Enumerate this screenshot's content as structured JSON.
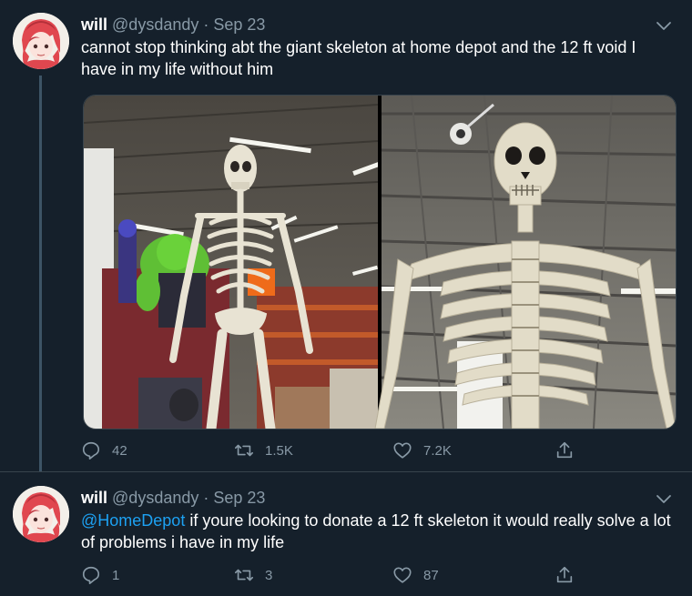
{
  "tweets": [
    {
      "name": "will",
      "handle": "@dysdandy",
      "separator": "·",
      "date": "Sep 23",
      "text": "cannot stop thinking abt the giant skeleton at home depot and the 12 ft void I have in my life without him",
      "replies": "42",
      "retweets": "1.5K",
      "likes": "7.2K"
    },
    {
      "name": "will",
      "handle": "@dysdandy",
      "separator": "·",
      "date": "Sep 23",
      "mention": "@HomeDepot",
      "text": " if youre looking to donate a 12 ft skeleton it would really solve a lot of problems i have in my life",
      "replies": "1",
      "retweets": "3",
      "likes": "87"
    }
  ],
  "colors": {
    "background": "#15202b",
    "muted": "#8899a6",
    "link": "#1da1f2",
    "divider": "#38444d"
  },
  "icons": [
    "chevron-down-icon",
    "reply-icon",
    "retweet-icon",
    "like-icon",
    "share-icon"
  ]
}
